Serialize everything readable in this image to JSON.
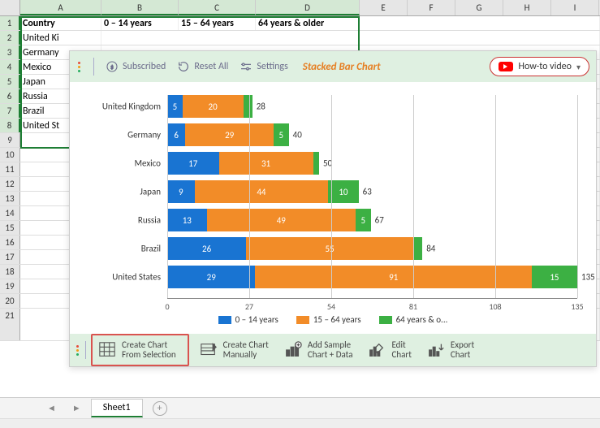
{
  "columns": [
    "A",
    "B",
    "C",
    "D",
    "E",
    "F",
    "G",
    "H",
    "I"
  ],
  "headers": {
    "A": "Country",
    "B": "0 – 14 years",
    "C": "15 – 64 years",
    "D": "64 years & older"
  },
  "rows": [
    {
      "n": 1
    },
    {
      "n": 2,
      "A": "United Kingdom"
    },
    {
      "n": 3,
      "A": "Germany"
    },
    {
      "n": 4,
      "A": "Mexico"
    },
    {
      "n": 5,
      "A": "Japan"
    },
    {
      "n": 6,
      "A": "Russia"
    },
    {
      "n": 7,
      "A": "Brazil"
    },
    {
      "n": 8,
      "A": "United States"
    }
  ],
  "panel": {
    "subscribed": "Subscribed",
    "reset": "Reset All",
    "settings": "Settings",
    "title": "Stacked Bar Chart",
    "howto": "How-to video"
  },
  "commands": {
    "create_sel": "Create Chart\nFrom Selection",
    "create_man": "Create Chart\nManually",
    "add_sample": "Add Sample\nChart + Data",
    "edit": "Edit\nChart",
    "export": "Export\nChart"
  },
  "sheet": {
    "name": "Sheet1"
  },
  "chart_data": {
    "type": "bar",
    "orientation": "horizontal-stacked",
    "categories": [
      "United Kingdom",
      "Germany",
      "Mexico",
      "Japan",
      "Russia",
      "Brazil",
      "United States"
    ],
    "series": [
      {
        "name": "0 – 14 years",
        "values": [
          5,
          6,
          17,
          9,
          13,
          26,
          29
        ]
      },
      {
        "name": "15 – 64 years",
        "values": [
          20,
          29,
          31,
          44,
          49,
          55,
          91
        ]
      },
      {
        "name": "64 years & older",
        "values": [
          3,
          5,
          2,
          10,
          5,
          3,
          15
        ]
      }
    ],
    "totals": [
      28,
      40,
      50,
      63,
      67,
      84,
      135
    ],
    "xlim": [
      0,
      135
    ],
    "xticks": [
      0,
      27,
      54,
      81,
      108,
      135
    ],
    "legend_labels": [
      "0 – 14 years",
      "15 – 64 years",
      "64 years & o..."
    ]
  }
}
